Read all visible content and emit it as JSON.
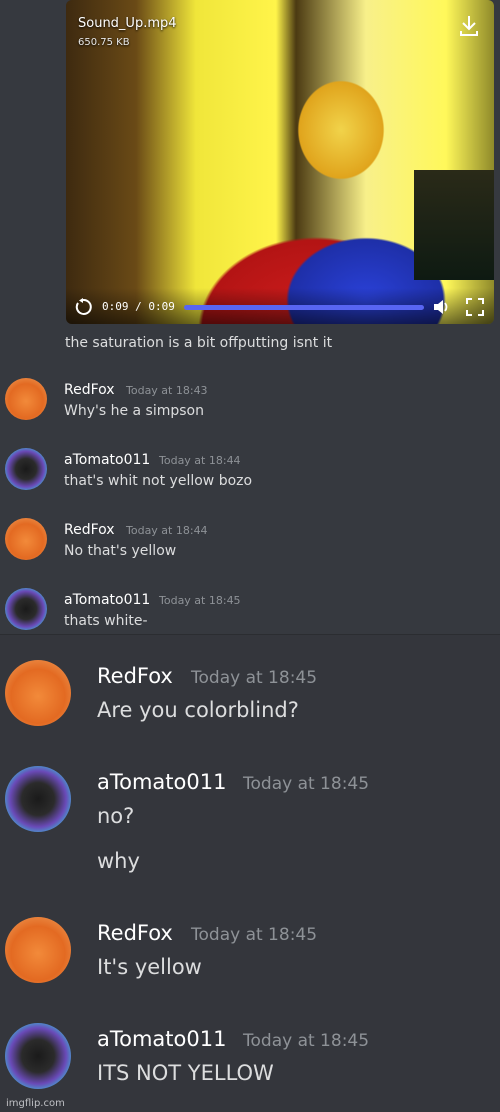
{
  "video": {
    "filename": "Sound_Up.mp4",
    "filesize": "650.75 KB",
    "time": "0:09 / 0:09",
    "progress": 1.0,
    "icons": [
      "download-icon",
      "replay-icon",
      "volume-icon",
      "fullscreen-icon"
    ],
    "accent": "#5865f2"
  },
  "caption": "the saturation is a bit offputting isnt it",
  "messages": [
    {
      "author": "RedFox",
      "timestamp": "Today at 18:43",
      "lines": [
        "Why's he a simpson"
      ]
    },
    {
      "author": "aTomato011",
      "timestamp": "Today at 18:44",
      "lines": [
        "that's whit not yellow bozo"
      ]
    },
    {
      "author": "RedFox",
      "timestamp": "Today at 18:44",
      "lines": [
        "No that's yellow"
      ]
    },
    {
      "author": "aTomato011",
      "timestamp": "Today at 18:45",
      "lines": [
        "thats white-"
      ]
    },
    {
      "author": "RedFox",
      "timestamp": "Today at 18:45",
      "lines": [
        "Are you colorblind?"
      ]
    },
    {
      "author": "aTomato011",
      "timestamp": "Today at 18:45",
      "lines": [
        "no?",
        "why"
      ]
    },
    {
      "author": "RedFox",
      "timestamp": "Today at 18:45",
      "lines": [
        "It's yellow"
      ]
    },
    {
      "author": "aTomato011",
      "timestamp": "Today at 18:45",
      "lines": [
        "ITS NOT YELLOW"
      ]
    }
  ],
  "watermark": "imgflip.com",
  "colors": {
    "background": "#36393f",
    "username": "#ffffff",
    "timestamp": "#8e9297",
    "text": "#dcddde"
  }
}
